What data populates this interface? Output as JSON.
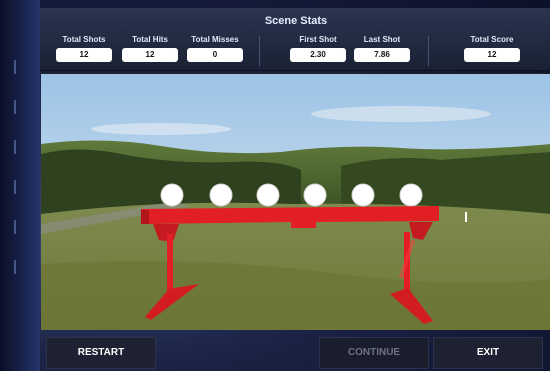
{
  "header": {
    "title": "Scene Stats"
  },
  "stats": [
    {
      "label": "Total Shots",
      "value": "12"
    },
    {
      "label": "Total Hits",
      "value": "12"
    },
    {
      "label": "Total Misses",
      "value": "0"
    },
    {
      "label": "First Shot",
      "value": "2.30"
    },
    {
      "label": "Last Shot",
      "value": "7.86"
    },
    {
      "label": "Total Score",
      "value": "12"
    }
  ],
  "buttons": {
    "restart": "RESTART",
    "continue": "CONTINUE",
    "exit": "EXIT"
  },
  "scene": {
    "target_count": 6,
    "target_color": "#ffffff",
    "frame_color": "#e31f26"
  }
}
